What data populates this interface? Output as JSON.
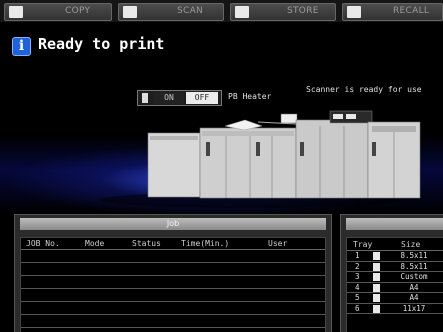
{
  "tabs": [
    {
      "label": "COPY",
      "icon": "copy-icon"
    },
    {
      "label": "SCAN",
      "icon": "scan-icon"
    },
    {
      "label": "STORE",
      "icon": "store-icon"
    },
    {
      "label": "RECALL",
      "icon": "recall-icon"
    }
  ],
  "status": {
    "icon": "info-icon",
    "message": "Ready to print"
  },
  "machine": {
    "heater_on_label": "ON",
    "heater_off_label": "OFF",
    "heater_label": "PB Heater",
    "heater_state": "OFF",
    "scanner_message": "Scanner is ready for use"
  },
  "job": {
    "title": "Job",
    "columns": [
      "JOB No.",
      "Mode",
      "Status",
      "Time(Min.)",
      "User"
    ],
    "rows": 7
  },
  "trays": {
    "columns": [
      "Tray",
      "Size"
    ],
    "rows": [
      {
        "tray": "1",
        "size": "8.5x11"
      },
      {
        "tray": "2",
        "size": "8.5x11"
      },
      {
        "tray": "3",
        "size": "Custom"
      },
      {
        "tray": "4",
        "size": "A4"
      },
      {
        "tray": "5",
        "size": "A4"
      },
      {
        "tray": "6",
        "size": "11x17"
      }
    ]
  },
  "colors": {
    "info_blue": "#1f63d6",
    "glow_blue": "#3c5aff"
  }
}
